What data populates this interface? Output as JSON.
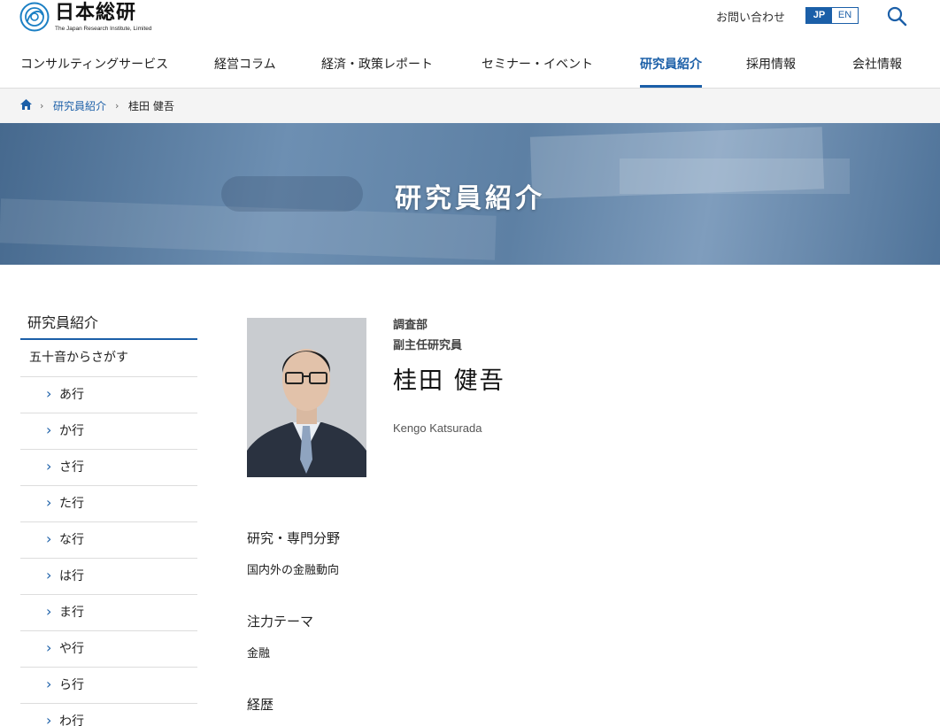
{
  "header": {
    "logo_jp": "日本総研",
    "logo_en": "The Japan Research Institute, Limited",
    "contact_label": "お問い合わせ",
    "lang_jp": "JP",
    "lang_en": "EN",
    "search_icon": "search-icon"
  },
  "nav": {
    "items": [
      {
        "label": "コンサルティングサービス"
      },
      {
        "label": "経営コラム"
      },
      {
        "label": "経済・政策レポート"
      },
      {
        "label": "セミナー・イベント"
      },
      {
        "label": "研究員紹介",
        "active": true
      },
      {
        "label": "採用情報"
      },
      {
        "label": "会社情報"
      }
    ]
  },
  "breadcrumb": {
    "home_icon": "home-icon",
    "items": [
      "研究員紹介",
      "桂田 健吾"
    ]
  },
  "hero": {
    "title": "研究員紹介"
  },
  "sidebar": {
    "title": "研究員紹介",
    "sub": "五十音からさがす",
    "items": [
      {
        "label": "あ行"
      },
      {
        "label": "か行"
      },
      {
        "label": "さ行"
      },
      {
        "label": "た行"
      },
      {
        "label": "な行"
      },
      {
        "label": "は行"
      },
      {
        "label": "ま行"
      },
      {
        "label": "や行"
      },
      {
        "label": "ら行"
      },
      {
        "label": "わ行"
      }
    ]
  },
  "profile": {
    "department": "調査部",
    "rank": "副主任研究員",
    "name": "桂田 健吾",
    "name_en": "Kengo Katsurada",
    "sections": [
      {
        "heading": "研究・専門分野",
        "value": "国内外の金融動向"
      },
      {
        "heading": "注力テーマ",
        "value": "金融"
      },
      {
        "heading": "経歴",
        "value": ""
      }
    ]
  },
  "colors": {
    "accent": "#1b5fa8",
    "breadcrumb_bg": "#f4f4f4"
  }
}
